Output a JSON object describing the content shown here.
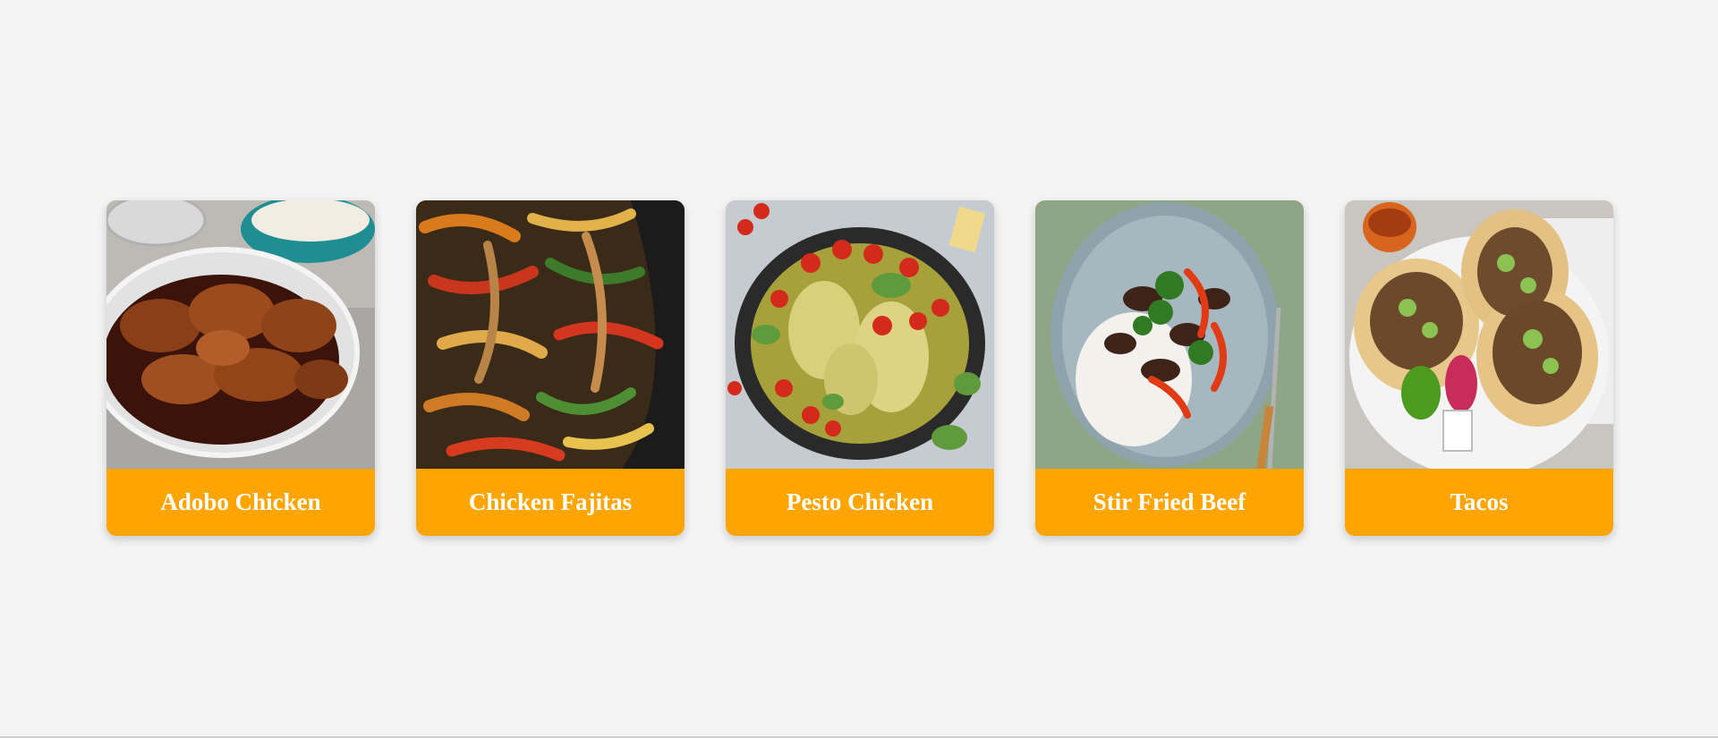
{
  "background": "#f4f4f4",
  "accent_color": "#ffa502",
  "title_color": "#ffffff",
  "cards": [
    {
      "title": "Adobo Chicken"
    },
    {
      "title": "Chicken Fajitas"
    },
    {
      "title": "Pesto Chicken"
    },
    {
      "title": "Stir Fried Beef"
    },
    {
      "title": "Tacos"
    }
  ]
}
